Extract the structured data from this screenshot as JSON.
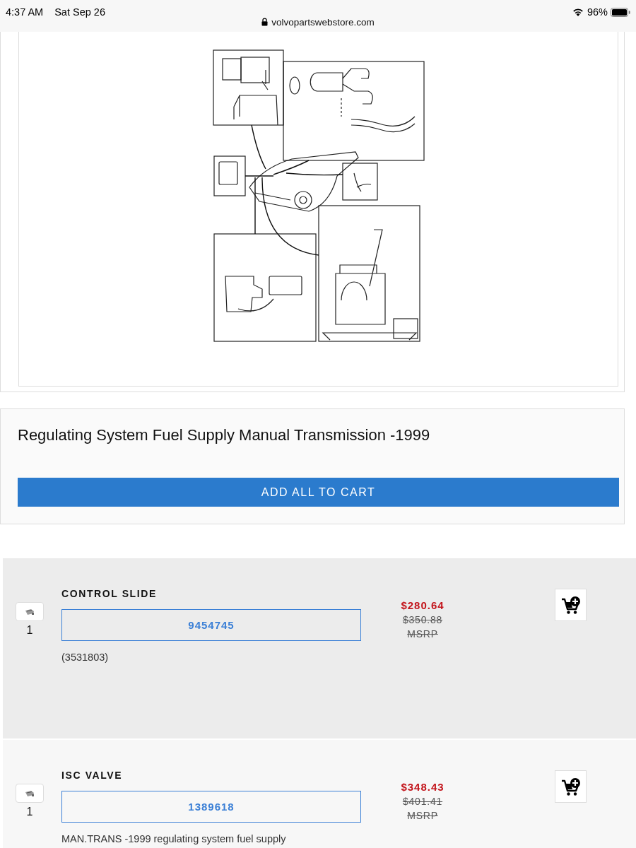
{
  "status_bar": {
    "time": "4:37 AM",
    "date": "Sat Sep 26",
    "battery": "96%"
  },
  "address_bar": {
    "url": "volvopartswebstore.com"
  },
  "assembly": {
    "title": "Regulating System Fuel Supply Manual Transmission -1999",
    "add_all_button": "ADD ALL TO CART"
  },
  "parts": [
    {
      "name": "CONTROL SLIDE",
      "quantity": "1",
      "part_number": "9454745",
      "note": "(3531803)",
      "price": "$280.64",
      "msrp_price": "$350.88",
      "msrp_label": "MSRP"
    },
    {
      "name": "ISC VALVE",
      "quantity": "1",
      "part_number": "1389618",
      "note": "MAN.TRANS -1999 regulating system fuel supply",
      "price": "$348.43",
      "msrp_price": "$401.41",
      "msrp_label": "MSRP"
    }
  ]
}
